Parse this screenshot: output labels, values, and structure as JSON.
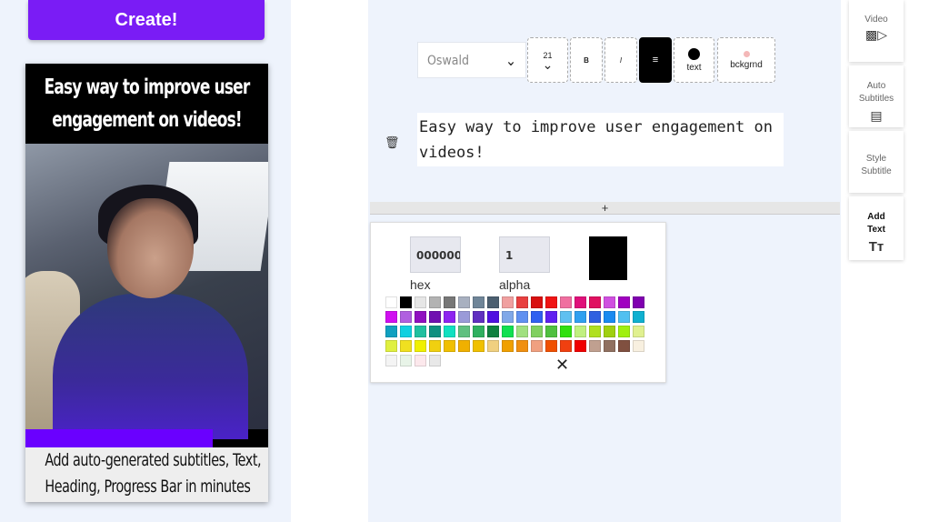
{
  "left": {
    "create_label": "Create!",
    "preview_heading": "Easy way to improve user engagement on videos!",
    "preview_caption_line1": "Add auto-generated subtitles, Text,",
    "preview_caption_line2": "Heading, Progress Bar in minutes",
    "progress_fraction": 0.77
  },
  "toolbar": {
    "font": "Oswald",
    "font_size": "21",
    "bold": "B",
    "italic": "I",
    "text_label": "text",
    "bg_label": "bckgrnd"
  },
  "editor": {
    "text_value": "Easy way to improve user engagement on videos!",
    "add_symbol": "+"
  },
  "picker": {
    "hex_value": "000000",
    "alpha_value": "1",
    "hex_label": "hex",
    "alpha_label": "alpha",
    "selected_color": "#000000",
    "swatches": [
      "#ffffff",
      "#000000",
      "#e6e6e6",
      "#b3b3b3",
      "#777777",
      "#a8b0c0",
      "#6f8598",
      "#4c5f70",
      "#f0a0a0",
      "#e84040",
      "#d81010",
      "#f01414",
      "#f06fa0",
      "#e0107a",
      "#e01060",
      "#d050e0",
      "#a000c0",
      "#8000b0",
      "#d010f0",
      "#b060e0",
      "#9010c0",
      "#7010b0",
      "#8e24f0",
      "#9a9ad8",
      "#6030c0",
      "#5010e0",
      "#80a8e8",
      "#6090f0",
      "#3060f0",
      "#6020f0",
      "#60c0f0",
      "#30a0f0",
      "#3060e0",
      "#1a8af0",
      "#50c0f0",
      "#10b0d0",
      "#10a0c0",
      "#10d0e0",
      "#20c0a0",
      "#109080",
      "#10e0c0",
      "#60c080",
      "#30b060",
      "#108040",
      "#10e050",
      "#a0e080",
      "#80d060",
      "#50c040",
      "#30e010",
      "#c0f080",
      "#b0e020",
      "#a0d010",
      "#a0f010",
      "#e0f090",
      "#e0f040",
      "#f0e020",
      "#f0f000",
      "#f0d010",
      "#f0c000",
      "#f0b000",
      "#f0c000",
      "#f0d080",
      "#f0a000",
      "#f09010",
      "#f0a080",
      "#f05000",
      "#f04010",
      "#f00000",
      "#c0a090",
      "#907060",
      "#805040",
      "#f8f0e0",
      "#f4f4f4",
      "#e8f4e8",
      "#fce8ec",
      "#e8e8e8"
    ]
  },
  "rail": [
    {
      "label": "Video",
      "icon": "video-camera-icon"
    },
    {
      "label": "Auto Subtitles",
      "icon": "subtitles-icon"
    },
    {
      "label": "Style Subtitle",
      "icon": ""
    },
    {
      "label": "Add Text",
      "icon": "text-icon"
    }
  ]
}
